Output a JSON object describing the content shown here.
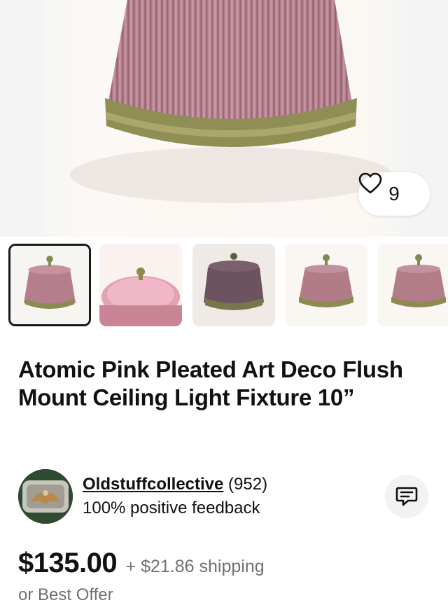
{
  "gallery": {
    "watch_count": "9",
    "watch_icon": "heart-icon",
    "thumbnails": [
      {
        "label": "photo-1",
        "selected": true
      },
      {
        "label": "photo-2",
        "selected": false
      },
      {
        "label": "photo-3",
        "selected": false
      },
      {
        "label": "photo-4",
        "selected": false
      },
      {
        "label": "photo-5",
        "selected": false
      }
    ]
  },
  "listing": {
    "title": "Atomic Pink Pleated Art Deco Flush Mount Ceiling Light Fixture 10”",
    "price": "$135.00",
    "shipping": "+ $21.86 shipping",
    "best_offer": "or Best Offer"
  },
  "seller": {
    "name": "Oldstuffcollective",
    "rating_count": "(952)",
    "feedback": "100% positive feedback",
    "message_icon": "message-icon"
  },
  "colors": {
    "pink": "#b98593",
    "brass": "#9a9a5c",
    "background": "#ffffff",
    "muted_text": "#707070"
  }
}
